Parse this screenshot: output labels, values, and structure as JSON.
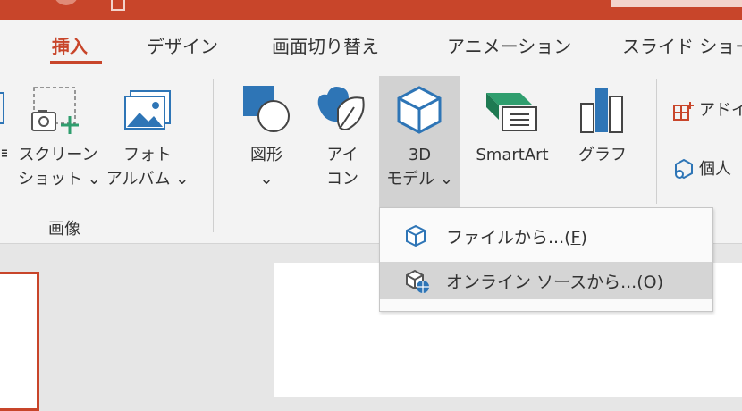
{
  "title_bar": {
    "accent": "#c8452a"
  },
  "tabs": [
    {
      "label": "挿入",
      "active": true
    },
    {
      "label": "デザイン"
    },
    {
      "label": "画面切り替え"
    },
    {
      "label": "アニメーション"
    },
    {
      "label": "スライド ショー"
    }
  ],
  "ribbon": {
    "screenshot": {
      "line1": "スクリーン",
      "line2": "ショット ⌄",
      "icon": "screenshot-icon"
    },
    "photo_album": {
      "line1": "フォト",
      "line2": "アルバム ⌄",
      "icon": "photo-album-icon"
    },
    "images_group_label": "画像",
    "shapes": {
      "line1": "図形",
      "line2": "⌄",
      "icon": "shapes-icon"
    },
    "icons": {
      "line1": "アイ",
      "line2": "コン",
      "icon": "bird-icon"
    },
    "model3d": {
      "line1": "3D",
      "line2": "モデル ⌄",
      "icon": "cube-icon"
    },
    "smartart": {
      "line1": "SmartArt",
      "icon": "smartart-icon"
    },
    "chart": {
      "line1": "グラフ",
      "icon": "chart-icon"
    },
    "addins": {
      "label": "アドイ",
      "icon": "addins-icon"
    },
    "personal": {
      "label": "個人",
      "icon": "personal-addins-icon"
    }
  },
  "dropdown": {
    "items": [
      {
        "label": "ファイルから...(",
        "key": "F",
        "close": ")"
      },
      {
        "label": "オンライン ソースから...(",
        "key": "O",
        "close": ")"
      }
    ]
  },
  "colors": {
    "accent": "#c8452a",
    "blue": "#2e75b6",
    "green": "#2f9e6e"
  }
}
